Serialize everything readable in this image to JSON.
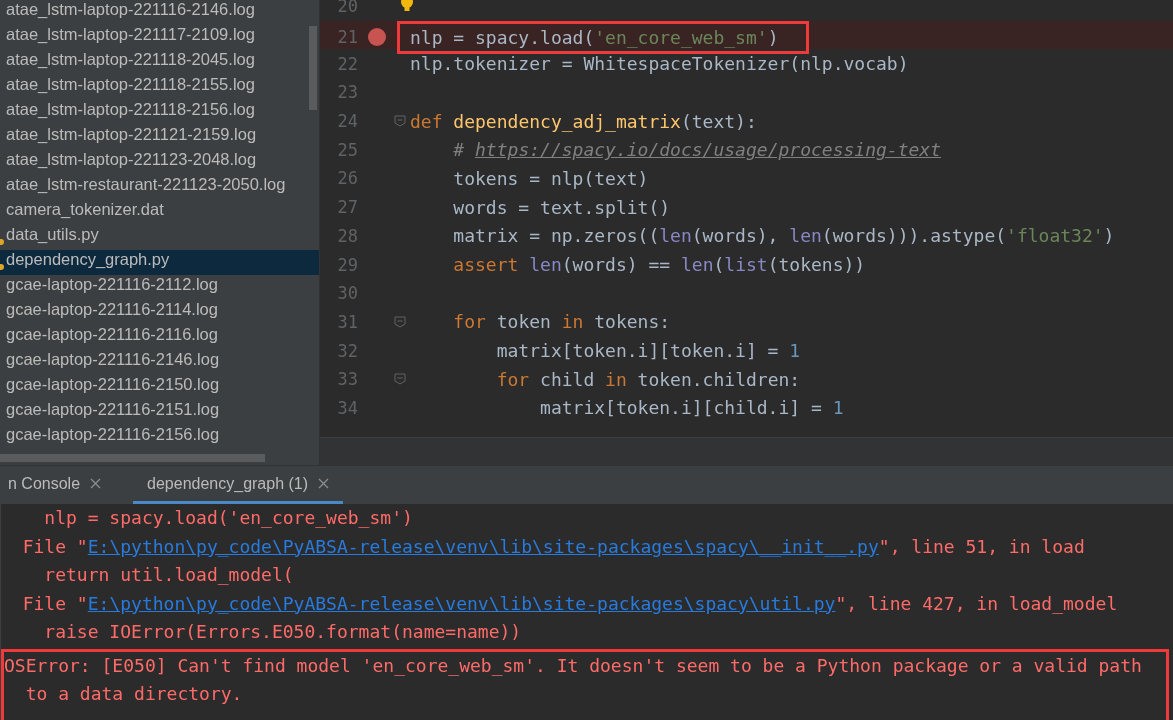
{
  "project_tree": {
    "items": [
      {
        "name": "atae_lstm-laptop-221116-2146.log",
        "selected": false,
        "marked": false
      },
      {
        "name": "atae_lstm-laptop-221117-2109.log",
        "selected": false,
        "marked": false
      },
      {
        "name": "atae_lstm-laptop-221118-2045.log",
        "selected": false,
        "marked": false
      },
      {
        "name": "atae_lstm-laptop-221118-2155.log",
        "selected": false,
        "marked": false
      },
      {
        "name": "atae_lstm-laptop-221118-2156.log",
        "selected": false,
        "marked": false
      },
      {
        "name": "atae_lstm-laptop-221121-2159.log",
        "selected": false,
        "marked": false
      },
      {
        "name": "atae_lstm-laptop-221123-2048.log",
        "selected": false,
        "marked": false
      },
      {
        "name": "atae_lstm-restaurant-221123-2050.log",
        "selected": false,
        "marked": false
      },
      {
        "name": "camera_tokenizer.dat",
        "selected": false,
        "marked": false
      },
      {
        "name": "data_utils.py",
        "selected": false,
        "marked": true
      },
      {
        "name": "dependency_graph.py",
        "selected": true,
        "marked": true
      },
      {
        "name": "gcae-laptop-221116-2112.log",
        "selected": false,
        "marked": false
      },
      {
        "name": "gcae-laptop-221116-2114.log",
        "selected": false,
        "marked": false
      },
      {
        "name": "gcae-laptop-221116-2116.log",
        "selected": false,
        "marked": false
      },
      {
        "name": "gcae-laptop-221116-2146.log",
        "selected": false,
        "marked": false
      },
      {
        "name": "gcae-laptop-221116-2150.log",
        "selected": false,
        "marked": false
      },
      {
        "name": "gcae-laptop-221116-2151.log",
        "selected": false,
        "marked": false
      },
      {
        "name": "gcae-laptop-221116-2156.log",
        "selected": false,
        "marked": false
      }
    ]
  },
  "editor": {
    "lines": [
      {
        "number": "20",
        "breakpoint": false,
        "highlighted": false,
        "annotated": false,
        "fold": false,
        "hint": true
      },
      {
        "number": "21",
        "breakpoint": true,
        "highlighted": true,
        "annotated": true,
        "fold": false,
        "hint": false,
        "tokens": [
          {
            "text": "nlp = spacy.load(",
            "kind": "plain"
          },
          {
            "text": "'en_core_web_sm'",
            "kind": "string"
          },
          {
            "text": ")",
            "kind": "plain"
          }
        ]
      },
      {
        "number": "22",
        "breakpoint": false,
        "highlighted": false,
        "annotated": false,
        "fold": false,
        "hint": false,
        "tokens": [
          {
            "text": "nlp.tokenizer = WhitespaceTokenizer(nlp.vocab)",
            "kind": "plain"
          }
        ]
      },
      {
        "number": "23",
        "breakpoint": false,
        "highlighted": false,
        "annotated": false,
        "fold": false,
        "hint": false
      },
      {
        "number": "24",
        "breakpoint": false,
        "highlighted": false,
        "annotated": false,
        "fold": true,
        "hint": false,
        "tokens": [
          {
            "text": "def ",
            "kind": "keyword"
          },
          {
            "text": "dependency_adj_matrix",
            "kind": "function"
          },
          {
            "text": "(text):",
            "kind": "plain"
          }
        ]
      },
      {
        "number": "25",
        "breakpoint": false,
        "highlighted": false,
        "annotated": false,
        "fold": false,
        "hint": false,
        "tokens": [
          {
            "text": "    # ",
            "kind": "comment"
          },
          {
            "text": "https://spacy.io/docs/usage/processing-text",
            "kind": "comment_link"
          }
        ]
      },
      {
        "number": "26",
        "breakpoint": false,
        "highlighted": false,
        "annotated": false,
        "fold": false,
        "hint": false,
        "tokens": [
          {
            "text": "    tokens = nlp(text)",
            "kind": "plain"
          }
        ]
      },
      {
        "number": "27",
        "breakpoint": false,
        "highlighted": false,
        "annotated": false,
        "fold": false,
        "hint": false,
        "tokens": [
          {
            "text": "    words = text.split()",
            "kind": "plain"
          }
        ]
      },
      {
        "number": "28",
        "breakpoint": false,
        "highlighted": false,
        "annotated": false,
        "fold": false,
        "hint": false,
        "tokens": [
          {
            "text": "    matrix = np.zeros((",
            "kind": "plain"
          },
          {
            "text": "len",
            "kind": "builtin"
          },
          {
            "text": "(words), ",
            "kind": "plain"
          },
          {
            "text": "len",
            "kind": "builtin"
          },
          {
            "text": "(words))).astype(",
            "kind": "plain"
          },
          {
            "text": "'float32'",
            "kind": "string"
          },
          {
            "text": ")",
            "kind": "plain"
          }
        ]
      },
      {
        "number": "29",
        "breakpoint": false,
        "highlighted": false,
        "annotated": false,
        "fold": false,
        "hint": false,
        "tokens": [
          {
            "text": "    assert ",
            "kind": "keyword"
          },
          {
            "text": "len",
            "kind": "builtin"
          },
          {
            "text": "(words) == ",
            "kind": "plain"
          },
          {
            "text": "len",
            "kind": "builtin"
          },
          {
            "text": "(",
            "kind": "plain"
          },
          {
            "text": "list",
            "kind": "builtin"
          },
          {
            "text": "(tokens))",
            "kind": "plain"
          }
        ]
      },
      {
        "number": "30",
        "breakpoint": false,
        "highlighted": false,
        "annotated": false,
        "fold": false,
        "hint": false
      },
      {
        "number": "31",
        "breakpoint": false,
        "highlighted": false,
        "annotated": false,
        "fold": true,
        "hint": false,
        "tokens": [
          {
            "text": "    for ",
            "kind": "keyword"
          },
          {
            "text": "token ",
            "kind": "plain"
          },
          {
            "text": "in ",
            "kind": "keyword"
          },
          {
            "text": "tokens:",
            "kind": "plain"
          }
        ]
      },
      {
        "number": "32",
        "breakpoint": false,
        "highlighted": false,
        "annotated": false,
        "fold": false,
        "hint": false,
        "tokens": [
          {
            "text": "        matrix[token.i][token.i] = ",
            "kind": "plain"
          },
          {
            "text": "1",
            "kind": "number"
          }
        ]
      },
      {
        "number": "33",
        "breakpoint": false,
        "highlighted": false,
        "annotated": false,
        "fold": true,
        "hint": false,
        "tokens": [
          {
            "text": "        for ",
            "kind": "keyword"
          },
          {
            "text": "child ",
            "kind": "plain"
          },
          {
            "text": "in ",
            "kind": "keyword"
          },
          {
            "text": "token.children:",
            "kind": "plain"
          }
        ]
      },
      {
        "number": "34",
        "breakpoint": false,
        "highlighted": false,
        "annotated": false,
        "fold": false,
        "hint": false,
        "tokens": [
          {
            "text": "            matrix[token.i][child.i] = ",
            "kind": "plain"
          },
          {
            "text": "1",
            "kind": "number"
          }
        ]
      }
    ]
  },
  "run_panel": {
    "tabs": [
      {
        "label": "n Console",
        "selected": false
      },
      {
        "label": "dependency_graph (1)",
        "selected": true
      }
    ],
    "output": [
      {
        "kind": "text",
        "annotated": false,
        "text": "    nlp = spacy.load('en_core_web_sm')"
      },
      {
        "kind": "file",
        "annotated": false,
        "prefix": "  File \"",
        "link": "E:\\python\\py_code\\PyABSA-release\\venv\\lib\\site-packages\\spacy\\__init__.py",
        "suffix": "\", line 51, in load"
      },
      {
        "kind": "text",
        "annotated": false,
        "text": "    return util.load_model("
      },
      {
        "kind": "file",
        "annotated": false,
        "prefix": "  File \"",
        "link": "E:\\python\\py_code\\PyABSA-release\\venv\\lib\\site-packages\\spacy\\util.py",
        "suffix": "\", line 427, in load_model"
      },
      {
        "kind": "text",
        "annotated": false,
        "text": "    raise IOError(Errors.E050.format(name=name))"
      },
      {
        "kind": "text",
        "annotated": true,
        "text": "OSError: [E050] Can't find model 'en_core_web_sm'. It doesn't seem to be a Python package or a valid path"
      },
      {
        "kind": "text",
        "annotated": true,
        "text": "  to a data directory."
      }
    ]
  }
}
